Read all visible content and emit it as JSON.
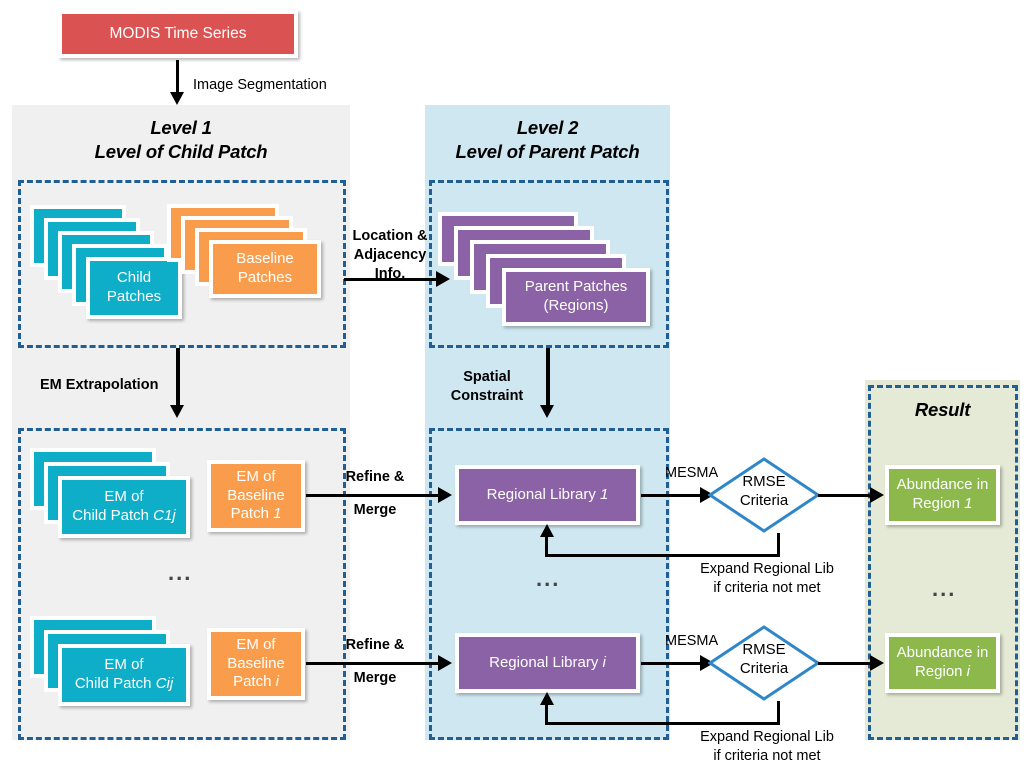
{
  "diagram": {
    "source_box": {
      "label": "MODIS Time Series"
    },
    "edges": {
      "image_segmentation": "Image Segmentation",
      "location_adjacency": "Location &\nAdjacency\nInfo.",
      "location_adjacency_l1": "Location &",
      "location_adjacency_l2": "Adjacency",
      "location_adjacency_l3": "Info.",
      "em_extrapolation": "EM Extrapolation",
      "spatial_constraint_l1": "Spatial",
      "spatial_constraint_l2": "Constraint",
      "refine_l1": "Refine &",
      "refine_l2": "Merge",
      "mesma": "MESMA",
      "expand_l1": "Expand Regional Lib",
      "expand_l2": "if criteria not met"
    },
    "panels": [
      {
        "id": "level1",
        "title_line1": "Level 1",
        "title_line2": "Level of Child Patch",
        "bg": "#f0f0f0"
      },
      {
        "id": "level2",
        "title_line1": "Level 2",
        "title_line2": "Level of Parent Patch",
        "bg": "#cfe7f0"
      },
      {
        "id": "result",
        "title_line1": "Result",
        "title_line2": "",
        "bg": "#e4ead5"
      }
    ],
    "nodes": {
      "child_patches": {
        "line1": "Child",
        "line2": "Patches"
      },
      "baseline_patches": {
        "line1": "Baseline",
        "line2": "Patches"
      },
      "parent_patches": {
        "line1": "Parent Patches",
        "line2": "(Regions)"
      },
      "em_child_1": {
        "line1": "EM of",
        "line2": "Child Patch ",
        "italic": "C1j"
      },
      "em_child_i": {
        "line1": "EM of",
        "line2": "Child Patch ",
        "italic": "Cij"
      },
      "em_baseline_1": {
        "line1": "EM of",
        "line2": "Baseline",
        "line3": "Patch ",
        "italic": "1"
      },
      "em_baseline_i": {
        "line1": "EM of",
        "line2": "Baseline",
        "line3": "Patch ",
        "italic": "i"
      },
      "regional_library_1": {
        "line1": "Regional Library ",
        "italic": "1"
      },
      "regional_library_i": {
        "line1": "Regional Library ",
        "italic": "i"
      },
      "rmse_1": {
        "line1": "RMSE",
        "line2": "Criteria"
      },
      "rmse_i": {
        "line1": "RMSE",
        "line2": "Criteria"
      },
      "abundance_1": {
        "line1": "Abundance in",
        "line2": "Region ",
        "italic": "1"
      },
      "abundance_i": {
        "line1": "Abundance in",
        "line2": "Region ",
        "italic": "i"
      }
    },
    "ellipsis": "...",
    "colors": {
      "red": "#da5352",
      "teal": "#0eadc8",
      "orange": "#f99d4c",
      "purple": "#8b62a5",
      "green": "#8cb84c",
      "dash_border": "#1f5f96",
      "diamond_stroke": "#2f86c8",
      "panel_level1": "#f0f0f0",
      "panel_level2": "#cfe7f0",
      "panel_result": "#e4ead5",
      "connector": "#000000"
    }
  }
}
